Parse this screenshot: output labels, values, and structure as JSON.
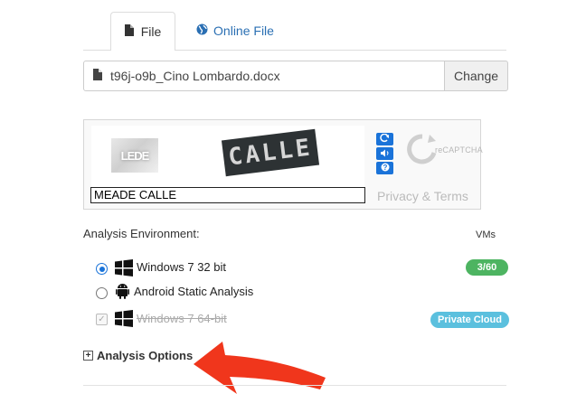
{
  "tabs": [
    {
      "label": "File",
      "icon": "file-icon",
      "active": true
    },
    {
      "label": "Online File",
      "icon": "globe-icon",
      "active": false
    }
  ],
  "file": {
    "name": "t96j-o9b_Cino Lombardo.docx",
    "change_label": "Change"
  },
  "captcha": {
    "word1": "LEDE",
    "word2": "CALLE",
    "input_value": "MEADE CALLE",
    "brand_text": "reCAPTCHA",
    "privacy_text": "Privacy & Terms"
  },
  "environment": {
    "title": "Analysis Environment:",
    "vms_label": "VMs",
    "options": [
      {
        "label": "Windows 7 32 bit",
        "type": "radio",
        "selected": true,
        "icon": "windows-icon",
        "badge": "3/60",
        "badge_color": "#4db461"
      },
      {
        "label": "Android Static Analysis",
        "type": "radio",
        "selected": false,
        "icon": "android-icon",
        "badge": "",
        "badge_color": ""
      },
      {
        "label": "Windows 7 64-bit",
        "type": "checkbox",
        "checked": true,
        "disabled": true,
        "icon": "windows-icon",
        "badge": "Private Cloud",
        "badge_color": "#5bc0de"
      }
    ]
  },
  "analysis_options": {
    "label": "Analysis Options"
  },
  "annotation": {
    "arrow_color": "#f0361c"
  },
  "colors": {
    "accent": "#1a73d9",
    "link": "#2a6fb3"
  }
}
